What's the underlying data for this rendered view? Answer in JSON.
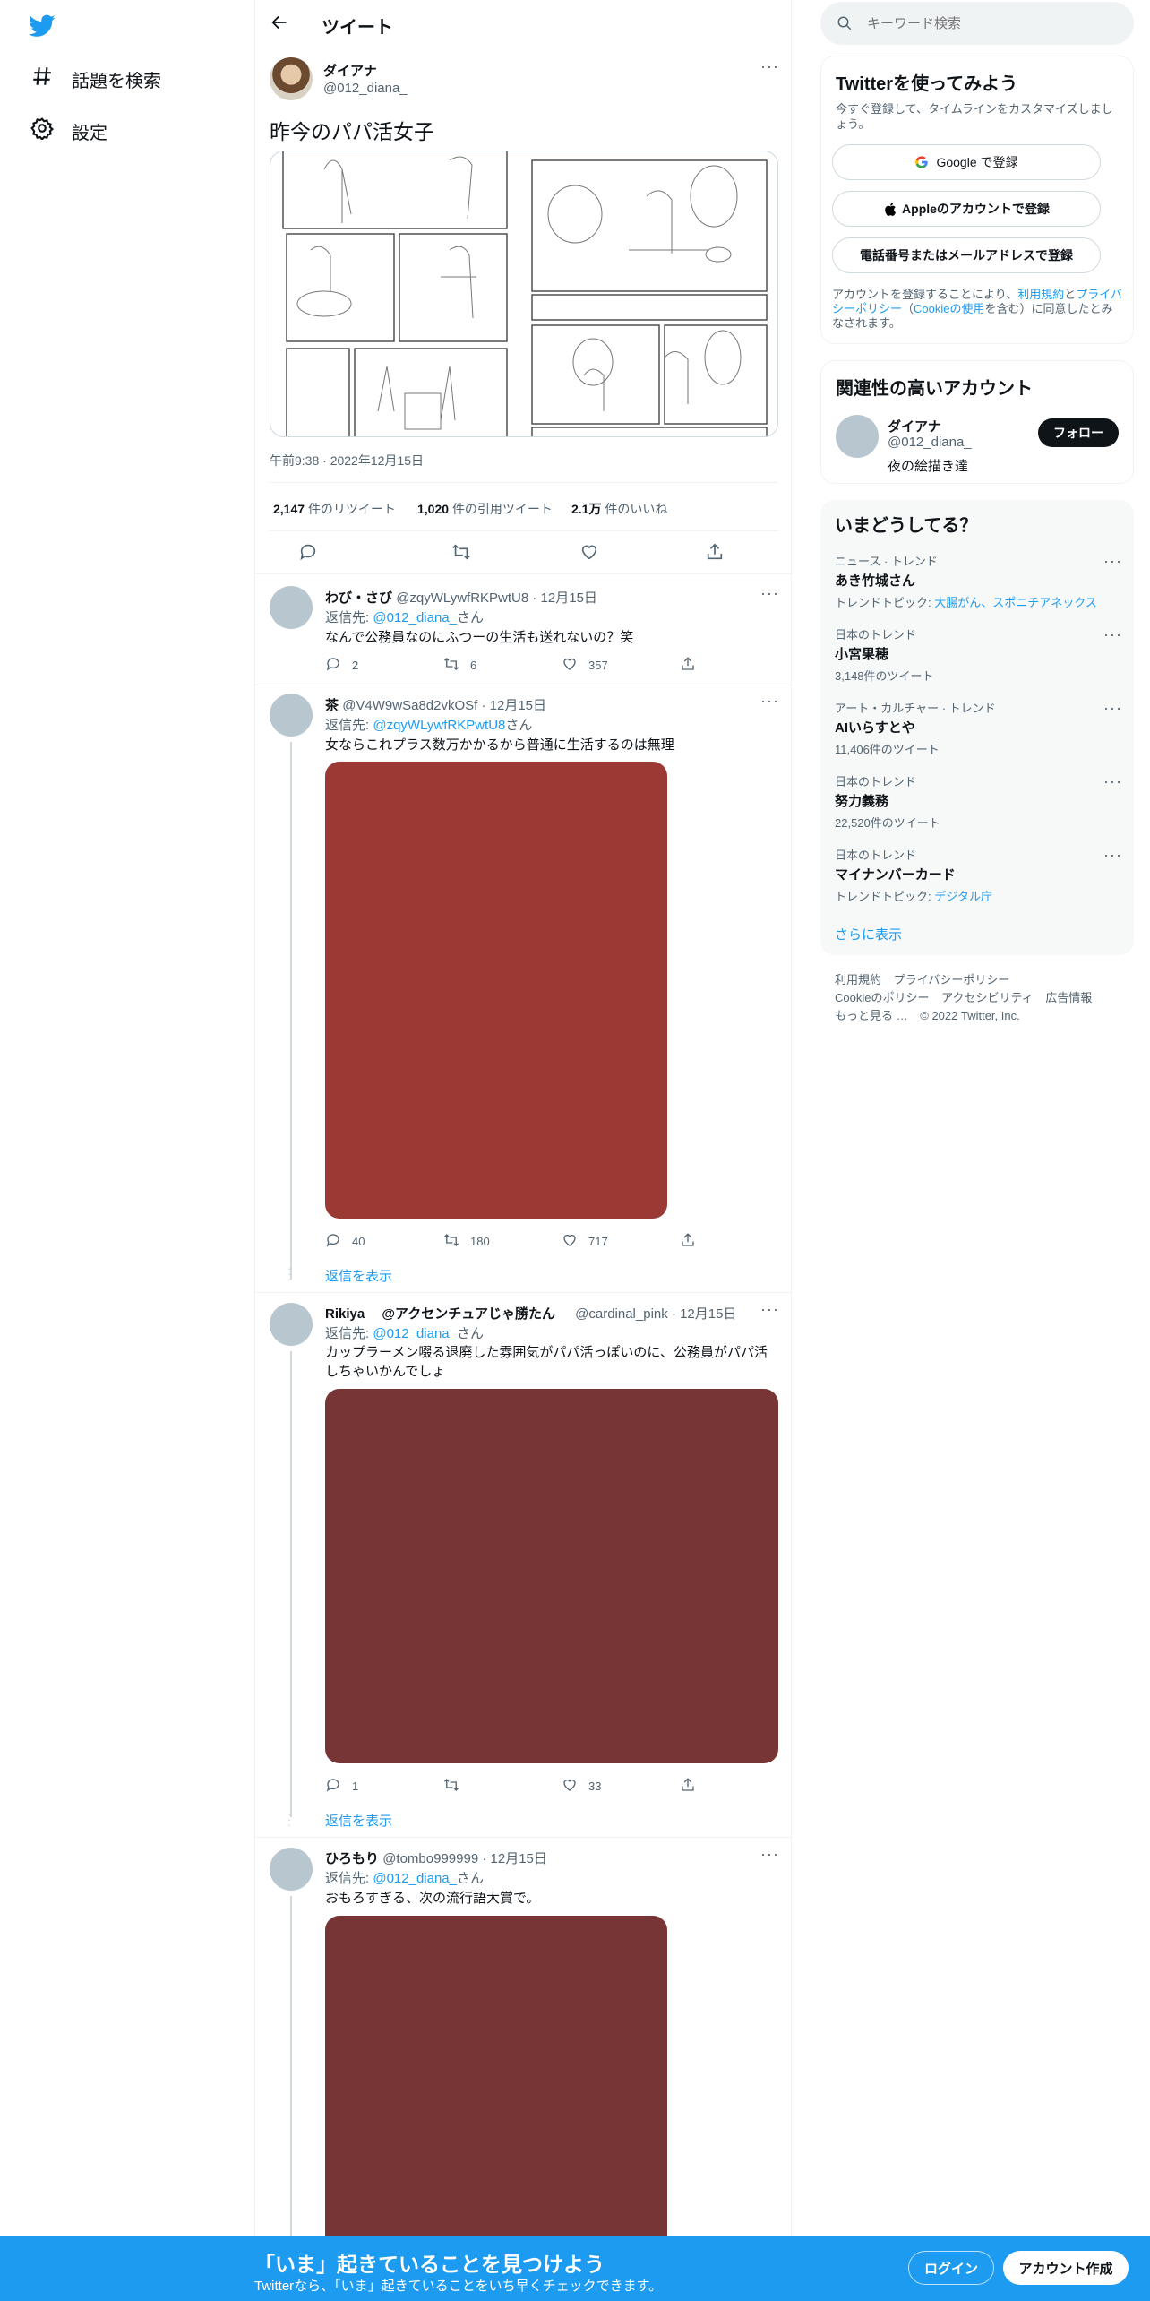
{
  "nav": {
    "explore_label": "話題を検索",
    "settings_label": "設定"
  },
  "header": {
    "title": "ツイート"
  },
  "main_tweet": {
    "name": "ダイアナ",
    "handle": "@012_diana_",
    "text": "昨今のパパ活女子",
    "timestamp": "午前9:38 · 2022年12月15日",
    "stats": {
      "retweets_count": "2,147",
      "retweets_label": "件のリツイート",
      "quotes_count": "1,020",
      "quotes_label": "件の引用ツイート",
      "likes_count": "2.1万",
      "likes_label": "件のいいね"
    }
  },
  "replies": [
    {
      "name": "わび・さび",
      "handle": "@zqyWLywfRKPwtU8",
      "date": "· 12月15日",
      "reply_prefix": "返信先: ",
      "reply_to": "@012_diana_",
      "reply_suffix": "さん",
      "text": "なんで公務員なのにふつーの生活も送れないの？笑",
      "replies": "2",
      "retweets": "6",
      "likes": "357"
    },
    {
      "name": "茶",
      "handle": "@V4W9wSa8d2vkOSf",
      "date": "· 12月15日",
      "reply_prefix": "返信先: ",
      "reply_to": "@zqyWLywfRKPwtU8",
      "reply_suffix": "さん",
      "text": "女ならこれプラス数万かかるから普通に生活するのは無理",
      "replies": "40",
      "retweets": "180",
      "likes": "717",
      "media_color": "#9b3a35"
    },
    {
      "name": "Rikiya　 @アクセンチュアじゃ勝たん",
      "handle": "@cardinal_pink",
      "date": "· 12月15日",
      "reply_prefix": "返信先: ",
      "reply_to": "@012_diana_",
      "reply_suffix": "さん",
      "text_line1": "カップラーメン啜る退廃した雰囲気がパパ活っぽいのに、公務員がパパ活",
      "text_line2": "しちゃいかんでしょ",
      "replies": "1",
      "retweets": "",
      "likes": "33",
      "media_color": "#773535"
    },
    {
      "name": "ひろもり",
      "handle": "@tombo999999",
      "date": "· 12月15日",
      "reply_prefix": "返信先: ",
      "reply_to": "@012_diana_",
      "reply_suffix": "さん",
      "text": "おもろすぎる、次の流行語大賞で。",
      "media_color": "#773535"
    }
  ],
  "show_replies_label": "返信を表示",
  "search": {
    "placeholder": "キーワード検索"
  },
  "signup": {
    "title": "Twitterを使ってみよう",
    "subtitle": "今すぐ登録して、タイムラインをカスタマイズしましょう。",
    "google_label": "Google で登録",
    "apple_label": "Appleのアカウントで登録",
    "phone_label": "電話番号またはメールアドレスで登録",
    "terms_prefix": "アカウントを登録することにより、",
    "terms_link": "利用規約",
    "terms_mid": "と",
    "privacy_link": "プライバシーポリシー",
    "cookie_prefix": "（",
    "cookie_link": "Cookieの使用",
    "terms_suffix": "を含む）に同意したとみなされます。"
  },
  "relevant": {
    "title": "関連性の高いアカウント",
    "name": "ダイアナ",
    "handle": "@012_diana_",
    "bio": "夜の絵描き達",
    "follow_label": "フォロー"
  },
  "trends": {
    "title": "いまどうしてる？",
    "items": [
      {
        "category": "ニュース · トレンド",
        "name": "あき竹城さん",
        "sub_prefix": "トレンドトピック: ",
        "sub_link": "大腸がん、スポニチアネックス"
      },
      {
        "category": "日本のトレンド",
        "name": "小宮果穂",
        "sub": "3,148件のツイート"
      },
      {
        "category": "アート・カルチャー · トレンド",
        "name": "AIいらすとや",
        "sub": "11,406件のツイート"
      },
      {
        "category": "日本のトレンド",
        "name": "努力義務",
        "sub": "22,520件のツイート"
      },
      {
        "category": "日本のトレンド",
        "name": "マイナンバーカード",
        "sub_prefix": "トレンドトピック: ",
        "sub_link": "デジタル庁"
      }
    ],
    "show_more": "さらに表示"
  },
  "footer": {
    "terms": "利用規約",
    "privacy": "プライバシーポリシー",
    "cookie": "Cookieのポリシー",
    "accessibility": "アクセシビリティ",
    "ads": "広告情報",
    "more": "もっと見る …",
    "copyright": "© 2022 Twitter, Inc."
  },
  "bottom": {
    "headline": "「いま」起きていることを見つけよう",
    "sub": "Twitterなら、「いま」起きていることをいち早くチェックできます。",
    "login_label": "ログイン",
    "signup_label": "アカウント作成"
  },
  "colors": {
    "accent": "#1d9bf0",
    "bottom_bar": "#1d9bf0"
  }
}
